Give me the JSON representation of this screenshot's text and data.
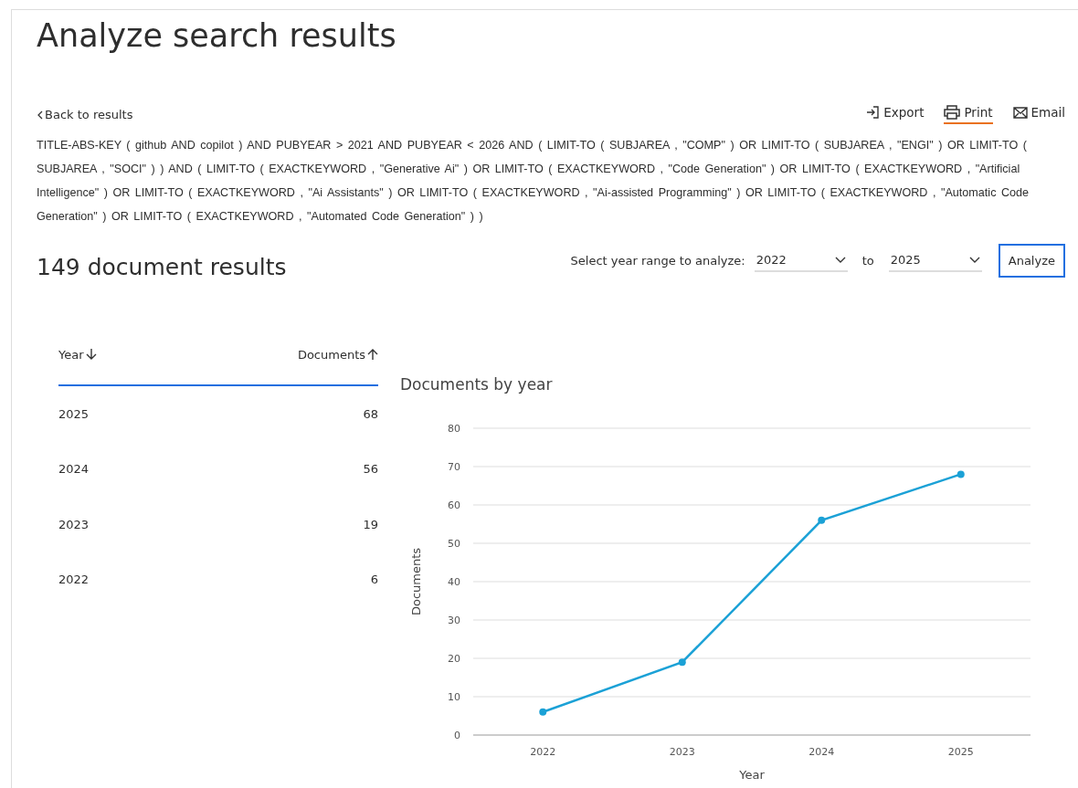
{
  "title": "Analyze search results",
  "back_link": {
    "label": "Back to results"
  },
  "actions": [
    {
      "kind": "export",
      "label": "Export",
      "selected": false
    },
    {
      "kind": "print",
      "label": "Print",
      "selected": true
    },
    {
      "kind": "email",
      "label": "Email",
      "selected": false
    }
  ],
  "query": "TITLE-ABS-KEY ( github AND copilot ) AND PUBYEAR > 2021 AND PUBYEAR < 2026 AND ( LIMIT-TO ( SUBJAREA , \"COMP\" ) OR LIMIT-TO ( SUBJAREA , \"ENGI\" ) OR LIMIT-TO ( SUBJAREA , \"SOCI\" ) ) AND ( LIMIT-TO ( EXACTKEYWORD , \"Generative Ai\" ) OR LIMIT-TO ( EXACTKEYWORD , \"Code Generation\" ) OR LIMIT-TO ( EXACTKEYWORD , \"Artificial Intelligence\" ) OR LIMIT-TO ( EXACTKEYWORD , \"Ai Assistants\" ) OR LIMIT-TO ( EXACTKEYWORD , \"Ai-assisted Programming\" ) OR LIMIT-TO ( EXACTKEYWORD , \"Automatic Code Generation\" ) OR LIMIT-TO ( EXACTKEYWORD , \"Automated Code Generation\" ) )",
  "result_count": "149 document results",
  "year_range": {
    "label": "Select year range to analyze:",
    "from": "2022",
    "separator": "to",
    "to": "2025",
    "button": "Analyze"
  },
  "table": {
    "columns": [
      {
        "label": "Year",
        "descending": true
      },
      {
        "label": "Documents",
        "descending": false
      }
    ],
    "rows": [
      [
        "2025",
        "68"
      ],
      [
        "2024",
        "56"
      ],
      [
        "2023",
        "19"
      ],
      [
        "2022",
        "6"
      ]
    ]
  },
  "chart": {
    "chart_data": {
      "type": "line",
      "title": "Documents by year",
      "xlabel": "Year",
      "ylabel": "Documents",
      "categories": [
        "2022",
        "2023",
        "2024",
        "2025"
      ],
      "series": [
        {
          "color": "#1ba1d6",
          "values": [
            6,
            19,
            56,
            68
          ],
          "marker": true
        }
      ],
      "grid": true,
      "ylim": [
        0,
        80
      ],
      "yticks": [
        0,
        10,
        20,
        30,
        40,
        50,
        60,
        70,
        80
      ]
    }
  }
}
